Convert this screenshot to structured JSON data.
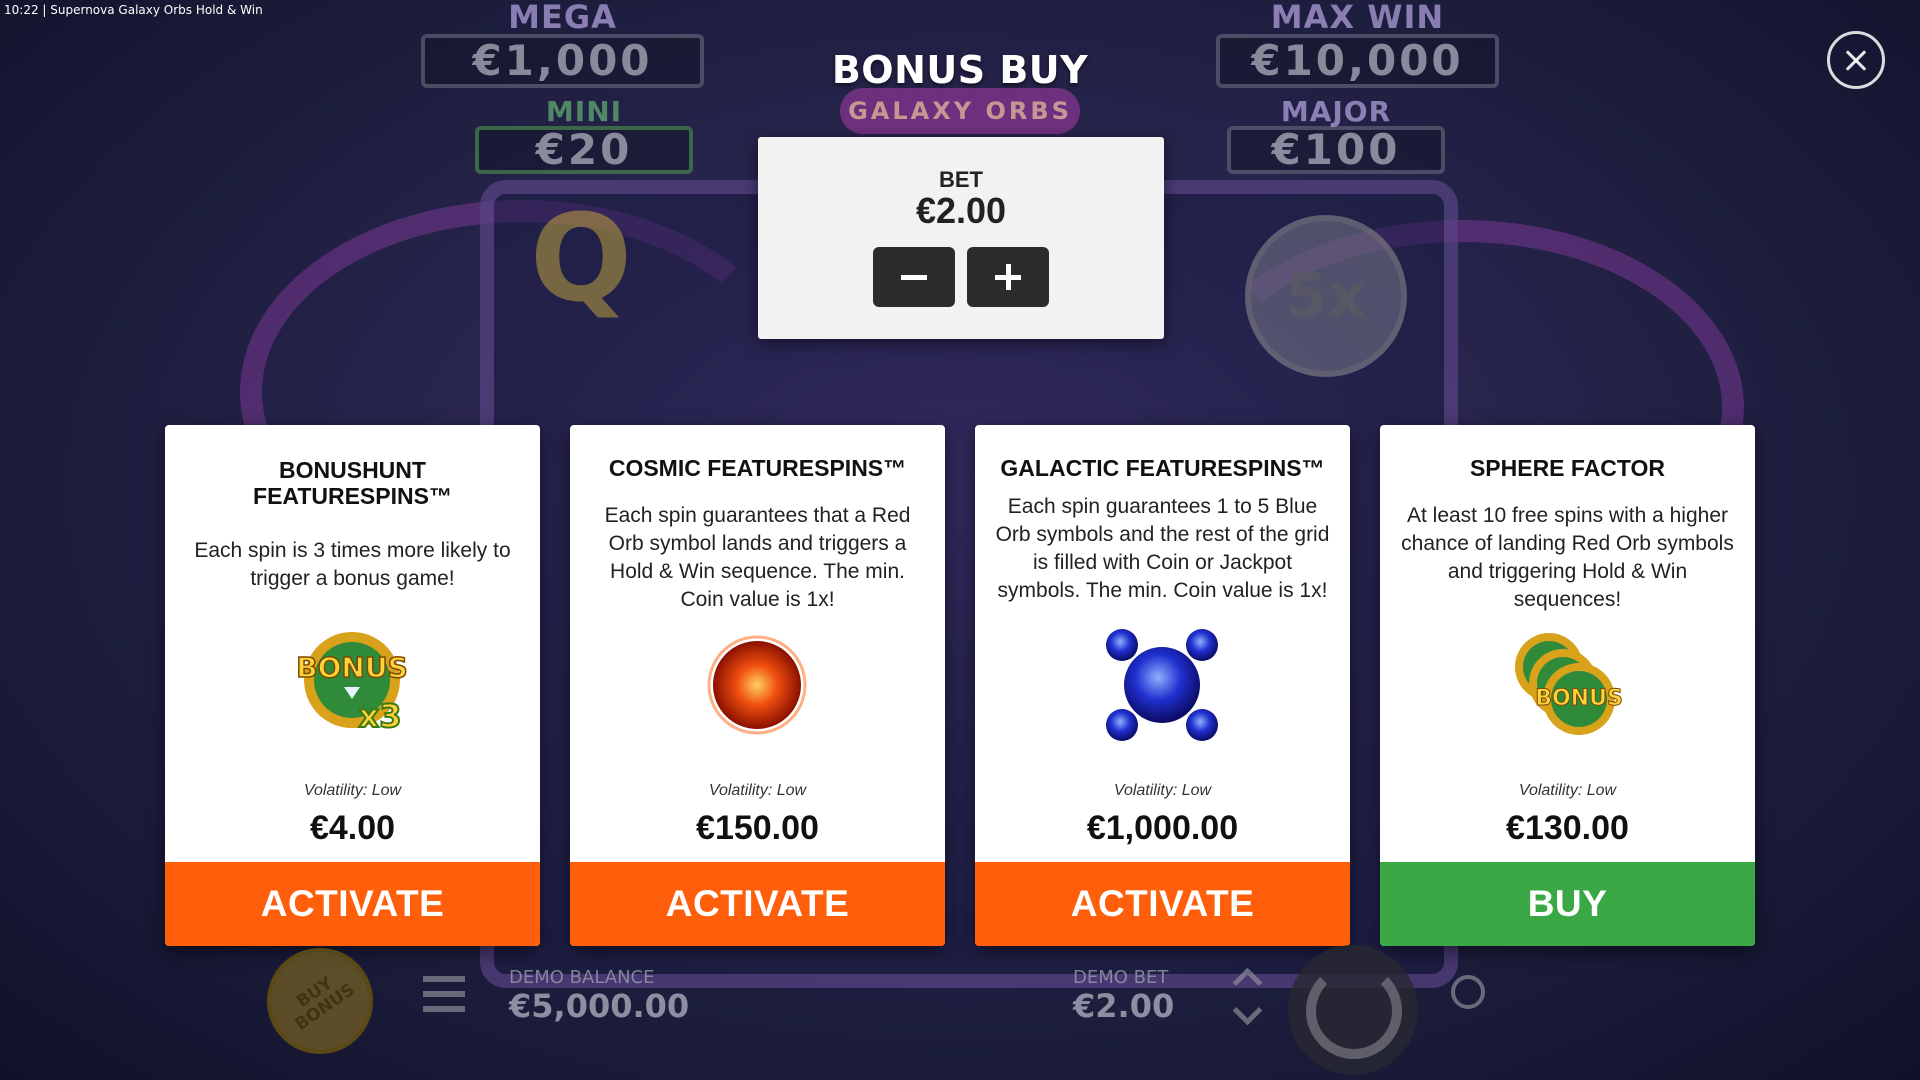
{
  "window": {
    "status_text": "10:22 | Supernova Galaxy Orbs Hold & Win"
  },
  "jackpots": {
    "mega": {
      "label": "MEGA",
      "value": "€1,000"
    },
    "mini": {
      "label": "MINI",
      "value": "€20"
    },
    "max_win": {
      "label": "MAX WIN",
      "value": "€10,000"
    },
    "major": {
      "label": "MAJOR",
      "value": "€100"
    }
  },
  "logo": {
    "subtitle": "GALAXY ORBS"
  },
  "background_symbols": {
    "q": "Q",
    "coin": "5x"
  },
  "dialog": {
    "title": "BONUS BUY",
    "close_icon": "close-icon",
    "bet": {
      "label": "BET",
      "value": "€2.00",
      "decrease_icon": "minus-icon",
      "increase_icon": "plus-icon"
    }
  },
  "cards": [
    {
      "title": "BONUSHUNT FEATURESPINS™",
      "description": "Each spin is 3 times more likely to trigger a bonus game!",
      "icon": "bonus-x3-icon",
      "volatility": "Volatility: Low",
      "price": "€4.00",
      "button": "ACTIVATE",
      "button_color": "#ff5f0a"
    },
    {
      "title": "COSMIC FEATURESPINS™",
      "description": "Each spin guarantees that a Red Orb symbol lands and triggers a Hold & Win sequence. The min. Coin value is 1x!",
      "icon": "red-orb-icon",
      "volatility": "Volatility: Low",
      "price": "€150.00",
      "button": "ACTIVATE",
      "button_color": "#ff5f0a"
    },
    {
      "title": "GALACTIC FEATURESPINS™",
      "description": "Each spin guarantees 1 to 5 Blue Orb symbols and the rest of the grid is filled with Coin or Jackpot symbols. The min. Coin value is 1x!",
      "icon": "blue-orbs-icon",
      "volatility": "Volatility: Low",
      "price": "€1,000.00",
      "button": "ACTIVATE",
      "button_color": "#ff5f0a"
    },
    {
      "title": "SPHERE FACTOR",
      "description": "At least 10 free spins with a higher chance of landing Red Orb symbols and triggering Hold & Win sequences!",
      "icon": "bonus-stack-icon",
      "volatility": "Volatility: Low",
      "price": "€130.00",
      "button": "BUY",
      "button_color": "#3aa845"
    }
  ],
  "bottom_bar": {
    "buy_bonus_label": "BUY BONUS",
    "demo_balance_label": "DEMO BALANCE",
    "demo_balance_value": "€5,000.00",
    "demo_bet_label": "DEMO BET",
    "demo_bet_value": "€2.00"
  }
}
